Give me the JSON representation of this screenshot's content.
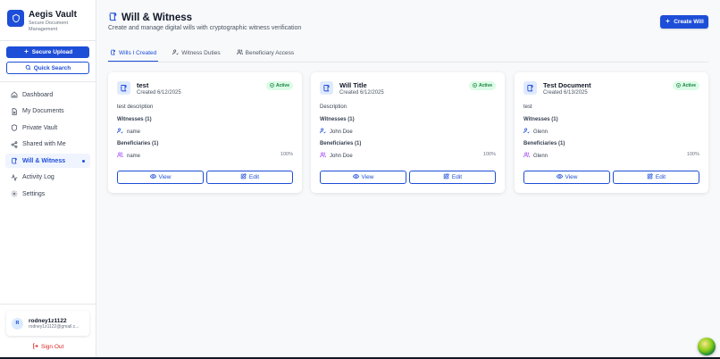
{
  "brand": {
    "name": "Aegis Vault",
    "subtitle": "Secure Document Management"
  },
  "sidebar": {
    "upload_label": "Secure Upload",
    "search_label": "Quick Search",
    "items": [
      {
        "label": "Dashboard",
        "icon": "home-icon"
      },
      {
        "label": "My Documents",
        "icon": "document-icon"
      },
      {
        "label": "Private Vault",
        "icon": "shield-icon"
      },
      {
        "label": "Shared with Me",
        "icon": "share-icon"
      },
      {
        "label": "Will & Witness",
        "icon": "scroll-icon",
        "active": true
      },
      {
        "label": "Activity Log",
        "icon": "activity-icon"
      },
      {
        "label": "Settings",
        "icon": "gear-icon"
      }
    ]
  },
  "user": {
    "initial": "R",
    "name": "rodney1z1122",
    "email": "rodney1z1122@gmail.c..."
  },
  "signout_label": "Sign Out",
  "header": {
    "title": "Will & Witness",
    "subtitle": "Create and manage digital wills with cryptographic witness verification",
    "create_label": "Create Will"
  },
  "tabs": [
    {
      "label": "Wills I Created",
      "active": true
    },
    {
      "label": "Witness Duties"
    },
    {
      "label": "Beneficiary Access"
    }
  ],
  "labels": {
    "witnesses": "Witnesses (1)",
    "beneficiaries": "Beneficiaries (1)",
    "view": "View",
    "edit": "Edit",
    "status": "Active"
  },
  "cards": [
    {
      "title": "test",
      "created": "Created 6/12/2025",
      "description": "test description",
      "witness": "name",
      "beneficiary": "name",
      "share": "100%"
    },
    {
      "title": "Will Title",
      "created": "Created 6/12/2025",
      "description": "Description",
      "witness": "John Doe",
      "beneficiary": "John Doe",
      "share": "100%"
    },
    {
      "title": "Test Document",
      "created": "Created 6/13/2025",
      "description": "test",
      "witness": "Glenn",
      "beneficiary": "Glenn",
      "share": "100%"
    }
  ],
  "colors": {
    "accent": "#1d4ed8",
    "active_badge_bg": "#dcfce7",
    "active_badge_text": "#15803d",
    "signout": "#dc2626",
    "beneficiary_icon": "#a855f7"
  }
}
